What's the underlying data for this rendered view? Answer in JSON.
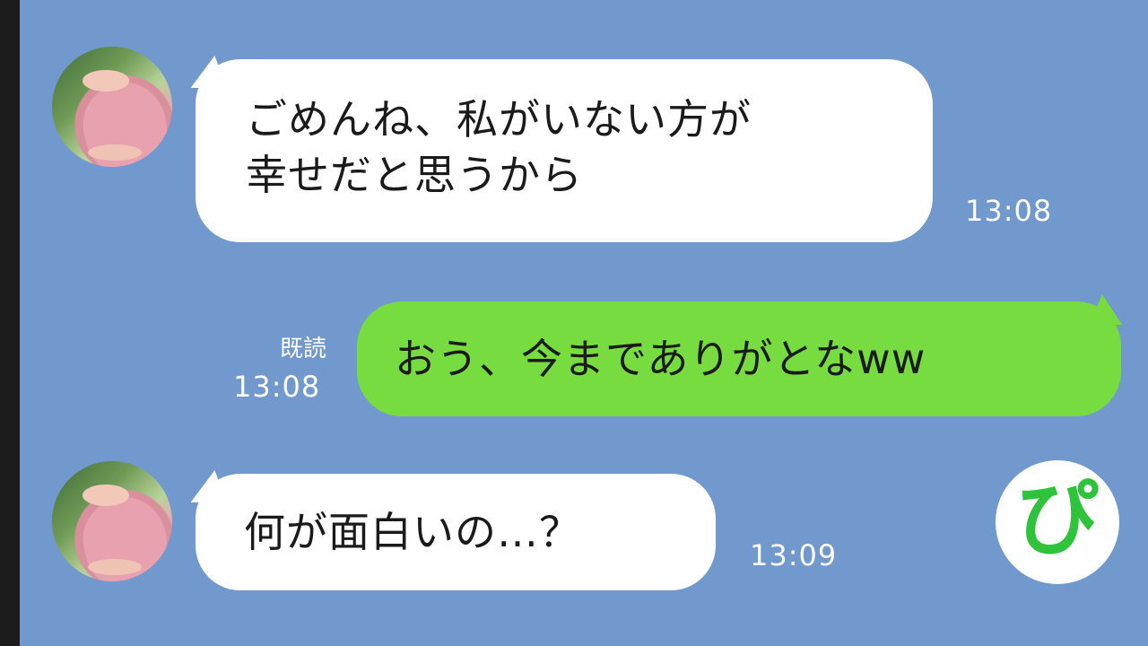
{
  "messages": [
    {
      "side": "incoming",
      "lines": [
        "ごめんね、私がいない方が",
        "幸せだと思うから"
      ],
      "time": "13:08"
    },
    {
      "side": "outgoing",
      "text": "おう、今までありがとなww",
      "read_label": "既読",
      "time": "13:08"
    },
    {
      "side": "incoming",
      "text": "何が面白いの…？",
      "time": "13:09"
    }
  ],
  "logo": {
    "glyph": "ぴ",
    "color": "#2fc23b"
  },
  "colors": {
    "background": "#7199cd",
    "incoming_bubble": "#ffffff",
    "outgoing_bubble": "#77dc40"
  }
}
